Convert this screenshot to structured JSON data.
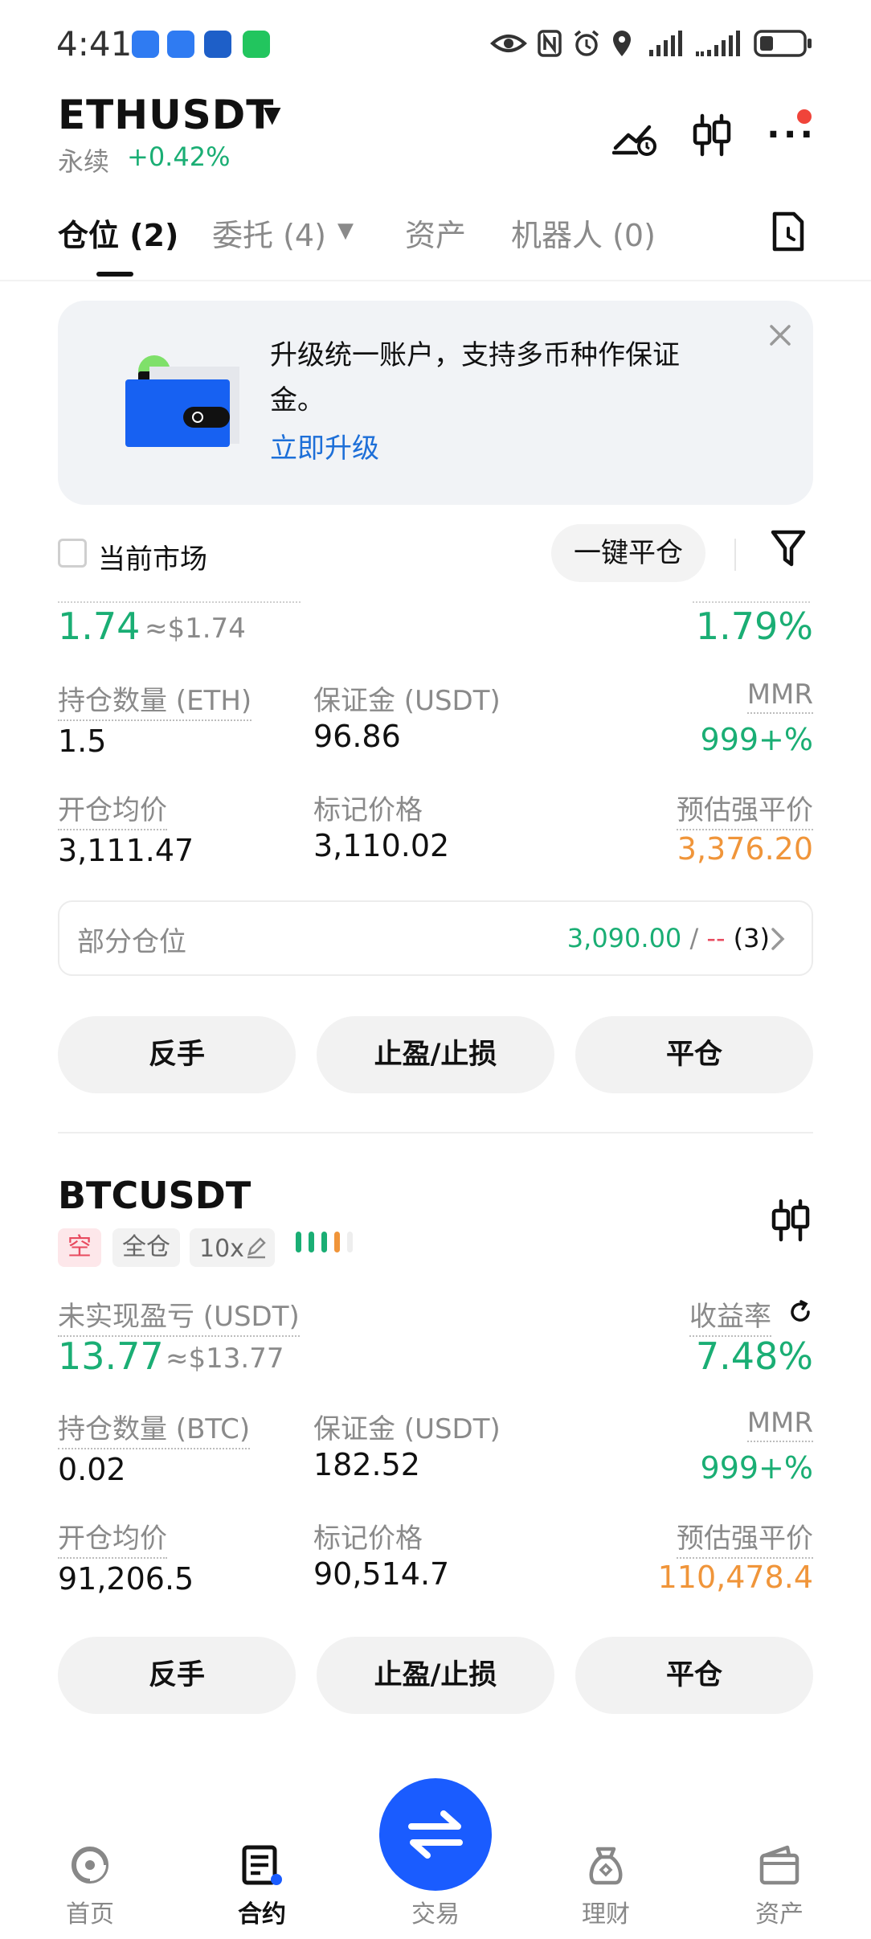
{
  "status_bar": {
    "time": "4:41"
  },
  "header": {
    "pair": "ETHUSDT",
    "type_label": "永续",
    "change": "+0.42%"
  },
  "tabs": [
    {
      "label": "仓位 (2)"
    },
    {
      "label": "委托 (4)"
    },
    {
      "label": "资产"
    },
    {
      "label": "机器人 (0)"
    }
  ],
  "banner": {
    "text": "升级统一账户，支持多币种作保证金。",
    "link": "立即升级"
  },
  "filter": {
    "current_market": "当前市场",
    "close_all": "一键平仓"
  },
  "position_eth": {
    "pnl": "1.74",
    "pnl_usd": "≈$1.74",
    "roi": "1.79%",
    "qty_label": "持仓数量 (ETH)",
    "qty": "1.5",
    "margin_label": "保证金 (USDT)",
    "margin": "96.86",
    "mmr_label": "MMR",
    "mmr": "999+%",
    "entry_label": "开仓均价",
    "entry": "3,111.47",
    "mark_label": "标记价格",
    "mark": "3,110.02",
    "liq_label": "预估强平价",
    "liq": "3,376.20",
    "partial_label": "部分仓位",
    "partial_tp": "3,090.00",
    "partial_sep": " / ",
    "partial_sl": "--",
    "partial_count": "(3)",
    "btn_reverse": "反手",
    "btn_tpsl": "止盈/止损",
    "btn_close": "平仓"
  },
  "position_btc": {
    "pair": "BTCUSDT",
    "side": "空",
    "margin_mode": "全仓",
    "leverage": "10x",
    "pnl_label": "未实现盈亏 (USDT)",
    "pnl": "13.77",
    "pnl_usd": "≈$13.77",
    "roi_label": "收益率",
    "roi": "7.48%",
    "qty_label": "持仓数量 (BTC)",
    "qty": "0.02",
    "margin_label": "保证金 (USDT)",
    "margin": "182.52",
    "mmr_label": "MMR",
    "mmr": "999+%",
    "entry_label": "开仓均价",
    "entry": "91,206.5",
    "mark_label": "标记价格",
    "mark": "90,514.7",
    "liq_label": "预估强平价",
    "liq": "110,478.4",
    "btn_reverse": "反手",
    "btn_tpsl": "止盈/止损",
    "btn_close": "平仓"
  },
  "bottom_nav": [
    {
      "label": "首页"
    },
    {
      "label": "合约"
    },
    {
      "label": "交易"
    },
    {
      "label": "理财"
    },
    {
      "label": "资产"
    }
  ],
  "colors": {
    "green": "#1aae74",
    "orange": "#f0953a",
    "link_blue": "#1d6fd8",
    "fab_blue": "#1a5cff",
    "short_red": "#e84a5f"
  }
}
